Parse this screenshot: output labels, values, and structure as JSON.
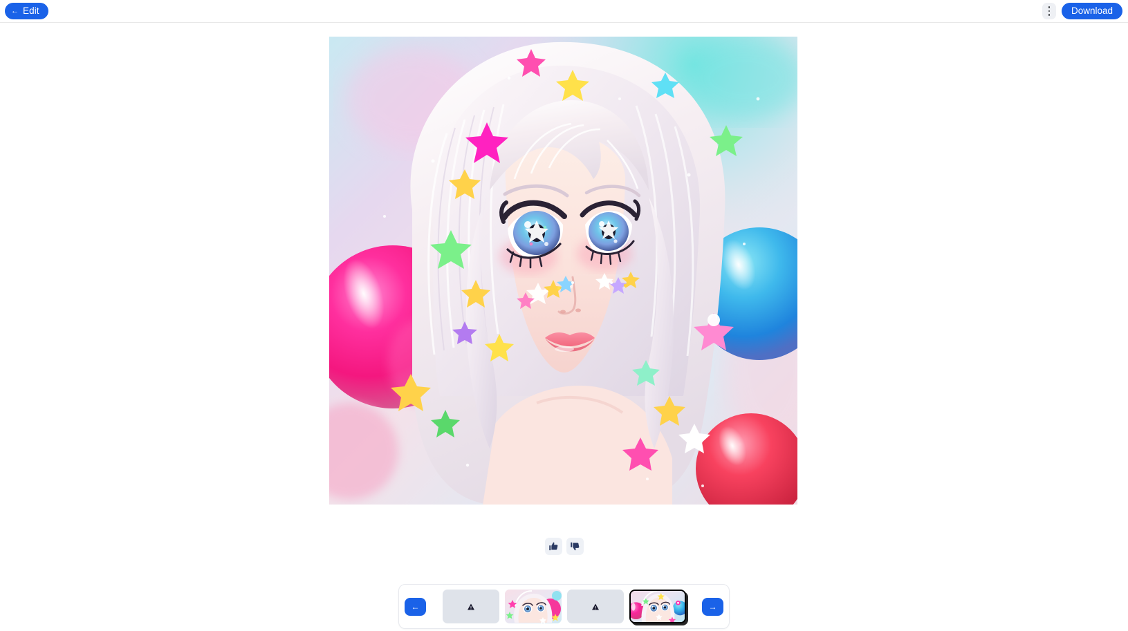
{
  "header": {
    "edit_button": {
      "label": "Edit",
      "icon": "back-arrow-icon",
      "glyph": "←"
    },
    "kebab_button": {
      "icon": "more-vertical-icon",
      "label": ""
    },
    "download_button": {
      "label": "Download"
    }
  },
  "main": {
    "image_alt": "Anime-style portrait of a girl with white hair, large blue sparkling eyes, colorful stars on her face, surrounded by pink and blue glossy balloons",
    "feedback": {
      "thumbs_up": {
        "icon": "thumbs-up-icon",
        "label": ""
      },
      "thumbs_down": {
        "icon": "thumbs-down-icon",
        "label": ""
      }
    }
  },
  "filmstrip": {
    "prev_button": {
      "icon": "arrow-left-icon",
      "glyph": "←"
    },
    "next_button": {
      "icon": "arrow-right-icon",
      "glyph": "→"
    },
    "thumbnails": [
      {
        "type": "placeholder",
        "icon": "broken-image-icon",
        "selected": false
      },
      {
        "type": "image",
        "icon": "",
        "selected": false
      },
      {
        "type": "placeholder",
        "icon": "broken-image-icon",
        "selected": false
      },
      {
        "type": "image",
        "icon": "",
        "selected": true
      }
    ]
  },
  "colors": {
    "accent": "#1a62e8",
    "header_border": "#e8e8e8",
    "placeholder_bg": "#dfe3ea",
    "icon_chip_bg": "#eef1f6",
    "feedback_glyph": "#2b3a63",
    "selected_border": "#000000"
  }
}
